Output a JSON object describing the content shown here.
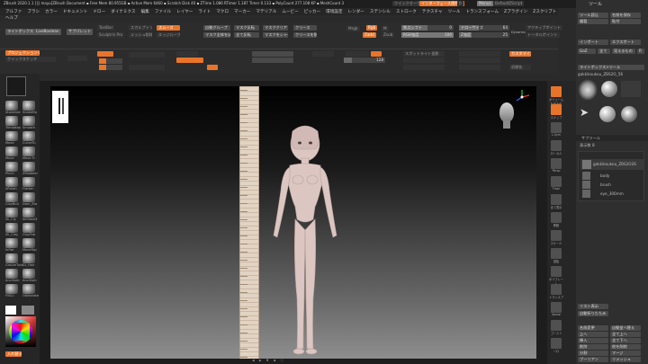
{
  "title_bar": {
    "text": "ZBrush 2020.1.1 [日 mayu]ZBrush Document   ▪ Free Mem 80.955GB ▪ Active Mem 6460 ▪ Scratch Disk 40 ▪ ZTime 1.086 RTimer 1.187 Timer 0.133 ▪ PolyCount 277.108 KP ▪ MeshCount 3",
    "quicksave": "クイックセーブ",
    "interface_transparency": "インターフェース透明度",
    "percent": "0",
    "menus": "Menus",
    "default_zscript": "DefaultZScript"
  },
  "menu_bar": {
    "items": [
      "アルファ",
      "ブラシ",
      "カラー",
      "ドキュメント",
      "ドロー",
      "ダイナミクス",
      "編集",
      "ファイル",
      "レイヤー",
      "ライト",
      "マクロ",
      "マーカー",
      "マテリアル",
      "ムービー",
      "ピッカー",
      "環境設定",
      "レンダー",
      "ステンシル",
      "ストローク",
      "テクスチャ",
      "ツール",
      "トランスフォーム",
      "Zプラグイン",
      "Zスクリプト"
    ],
    "help": "ヘルプ"
  },
  "top_shelf": {
    "lightbox": "ライトボックス",
    "live_boolean": "LiveBoolean",
    "sub_palette": "サブパレット",
    "toolbar_sculptris": "ToolBar",
    "add_sculpt": "Sculptris Pro",
    "resolution_row": [
      "スカルプトリス",
      "メッシュ削除",
      "スムース",
      "自動グループ",
      "マスク反転",
      "マスククリア",
      "クリース"
    ],
    "row2": [
      "スカルプトリス",
      "スカルプトリス",
      "エッジループ",
      "マスク全体をぼかし",
      "全て反転",
      "マスクをシャープに",
      "クリースを削除"
    ],
    "mrgb": "Mrgb",
    "rgb": "Rgb",
    "m": "M",
    "zadd": "Zadd",
    "zsub": "Zsub",
    "focal_shift_label": "焦点シフト",
    "focal_shift": "0",
    "draw_size_label": "ドローサイズ",
    "draw_size": "64",
    "z_intensity_label": "Z強度",
    "z_intensity": "25",
    "rgb_intensity_label": "RGB強度",
    "rgb_intensity": "100",
    "dynamic": "Dynamic",
    "active_points": "アクティブポイント",
    "total_points": "トータルポイント",
    "spotlight_projection": "スポットライト投影",
    "dynamesh_res": "128",
    "enable_customize": "カスタマイズ",
    "default_ui": "初期化"
  },
  "left_panel": {
    "projection_master": "プロジェクションマスター",
    "quick_sketch": "クイックスケッチ",
    "brushes": [
      {
        "name": "Standard"
      },
      {
        "name": "SnakeHo"
      },
      {
        "name": "TrimAdap"
      },
      {
        "name": "Smooth"
      },
      {
        "name": "Move"
      },
      {
        "name": "CurveTu"
      },
      {
        "name": "Move"
      },
      {
        "name": "Move Tr"
      },
      {
        "name": "Pinch"
      },
      {
        "name": "ZModeler"
      },
      {
        "name": "hPolish"
      },
      {
        "name": "Flatten"
      },
      {
        "name": "ClayBuil"
      },
      {
        "name": "Dam_Sta"
      },
      {
        "name": "Sk_Cly"
      },
      {
        "name": "SkSlash3"
      },
      {
        "name": "Sk_Clay"
      },
      {
        "name": "ClayTub"
      },
      {
        "name": "Inflat"
      },
      {
        "name": "MoveTop"
      },
      {
        "name": "GroomTurb"
      },
      {
        "name": "Gr_Hair"
      },
      {
        "name": "Ancillum"
      },
      {
        "name": "Ancillum"
      },
      {
        "name": "FillCu"
      },
      {
        "name": "Obliterate"
      }
    ],
    "tool_label": "入れ替え",
    "color_accent": "#e8742a"
  },
  "tool_panel": {
    "title": "ツール",
    "load_tool": "ツール読込",
    "save_as": "名前を保存",
    "copy": "複製",
    "paste": "貼付",
    "import": "インポート",
    "export": "エクスポート",
    "goz": "GoZ",
    "all": "全て",
    "visible": "見えるもの",
    "r": "R",
    "lightbox_tools": "ライトボックス>ツール",
    "current_tool": "gakkikoukou_ZBS2O_56",
    "count": "56",
    "tools": [
      "gakkikouk",
      "PM3D_Sphere",
      "SimpleBrush",
      "gakkikouko",
      "Skin_Z",
      "PM3D_Sp",
      "Arrow",
      "kouko",
      "gakkikou"
    ],
    "subtool_title": "サブツール",
    "visible_count_label": "表示数",
    "visible_count": "8",
    "subtool_names": [
      "gakkikoukou_ZBS2O26",
      "body",
      "brush",
      "eye_300mm"
    ],
    "list_all": "リスト表示",
    "auto_collapse": "自動折りたたみ",
    "actions": [
      "名前変更",
      "自動並べ替え",
      "上へ",
      "全て上へ",
      "全て下へ",
      "挿入",
      "削除",
      "他を削除",
      "削除",
      "全て削除"
    ],
    "split": "分割",
    "merge": "マージ",
    "boolean": "ブーリアン",
    "remesh": "リメッシュ",
    "project": "投影",
    "extract": "抽出",
    "polygroups": "ポリグループ"
  },
  "right_shelf": {
    "items": [
      "ボリュームを最大化",
      "スナップ",
      "L.Sym",
      "ローカル",
      "Persp",
      "Floor",
      "全て表示",
      "移動",
      "スケール",
      "回転",
      "ポリフレーム",
      "トランスプ",
      "Xpose",
      "ゴースト",
      "ソロ"
    ]
  },
  "canvas": {
    "background_top": "#000000",
    "background_bottom": "#8a8a8a",
    "figure_color": "#e0c9c4",
    "ruler_color": "#d8c8b8"
  }
}
